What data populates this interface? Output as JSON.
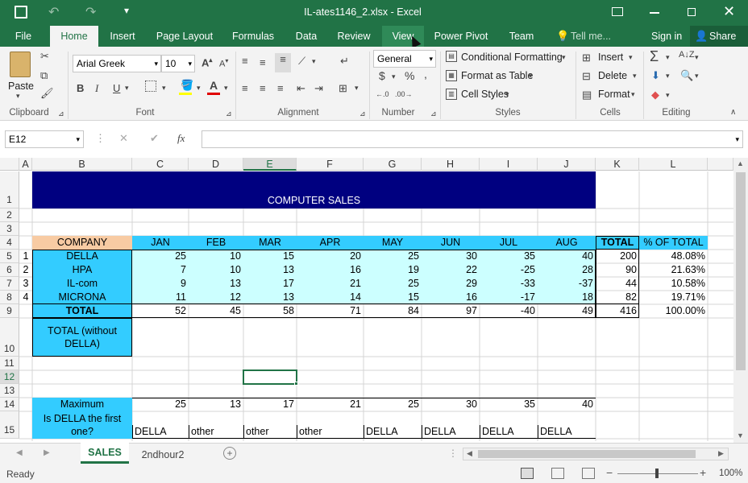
{
  "title": "IL-ates1146_2.xlsx - Excel",
  "tabs": [
    "File",
    "Home",
    "Insert",
    "Page Layout",
    "Formulas",
    "Data",
    "Review",
    "View",
    "Power Pivot",
    "Team"
  ],
  "tell_me": "Tell me...",
  "sign_in": "Sign in",
  "share": "Share",
  "clipboard": {
    "paste": "Paste",
    "label": "Clipboard"
  },
  "font": {
    "name": "Arial Greek",
    "size": "10",
    "label": "Font",
    "bold": "B",
    "italic": "I",
    "underline": "U"
  },
  "alignment": {
    "label": "Alignment"
  },
  "number": {
    "format": "General",
    "label": "Number",
    "currency": "$",
    "percent": "%",
    "comma": ","
  },
  "styles": {
    "conditional": "Conditional Formatting",
    "table": "Format as Table",
    "cell": "Cell Styles",
    "label": "Styles"
  },
  "cells": {
    "insert": "Insert",
    "delete": "Delete",
    "format": "Format",
    "label": "Cells"
  },
  "editing": {
    "label": "Editing"
  },
  "namebox": "E12",
  "fx": "fx",
  "columns": [
    "A",
    "B",
    "C",
    "D",
    "E",
    "F",
    "G",
    "H",
    "I",
    "J",
    "K",
    "L"
  ],
  "rows": [
    "1",
    "2",
    "3",
    "4",
    "5",
    "6",
    "7",
    "8",
    "9",
    "10",
    "11",
    "12",
    "13",
    "14",
    "15"
  ],
  "sheet": {
    "title": "COMPUTER SALES",
    "header": [
      "COMPANY",
      "JAN",
      "FEB",
      "MAR",
      "APR",
      "MAY",
      "JUN",
      "JUL",
      "AUG",
      "TOTAL",
      "% OF TOTAL"
    ],
    "data": [
      {
        "n": "1",
        "company": "DELLA",
        "values": [
          "25",
          "10",
          "15",
          "20",
          "25",
          "30",
          "35",
          "40"
        ],
        "total": "200",
        "pct": "48.08%"
      },
      {
        "n": "2",
        "company": "HPA",
        "values": [
          "7",
          "10",
          "13",
          "16",
          "19",
          "22",
          "-25",
          "28"
        ],
        "total": "90",
        "pct": "21.63%"
      },
      {
        "n": "3",
        "company": "IL-com",
        "values": [
          "9",
          "13",
          "17",
          "21",
          "25",
          "29",
          "-33",
          "-37"
        ],
        "total": "44",
        "pct": "10.58%"
      },
      {
        "n": "4",
        "company": "MICRONA",
        "values": [
          "11",
          "12",
          "13",
          "14",
          "15",
          "16",
          "-17",
          "18"
        ],
        "total": "82",
        "pct": "19.71%"
      }
    ],
    "total_row": {
      "label": "TOTAL",
      "values": [
        "52",
        "45",
        "58",
        "71",
        "84",
        "97",
        "-40",
        "49"
      ],
      "total": "416",
      "pct": "100.00%"
    },
    "row10_line1": "TOTAL   (without",
    "row10_line2": "DELLA)",
    "max_row": {
      "label": "Maximum",
      "values": [
        "25",
        "13",
        "17",
        "21",
        "25",
        "30",
        "35",
        "40"
      ]
    },
    "first_row": {
      "label_line1": "Is DELLA the first",
      "label_line2": "one?",
      "values": [
        "DELLA",
        "other",
        "other",
        "other",
        "DELLA",
        "DELLA",
        "DELLA",
        "DELLA"
      ]
    }
  },
  "sheet_tabs": [
    "SALES",
    "2ndhour2"
  ],
  "status": {
    "ready": "Ready",
    "zoom": "100%"
  },
  "colors": {
    "green": "#217346",
    "navy": "#000080",
    "cyan": "#33ccff",
    "lightcyan": "#ccffff",
    "peach": "#f8cba3"
  }
}
